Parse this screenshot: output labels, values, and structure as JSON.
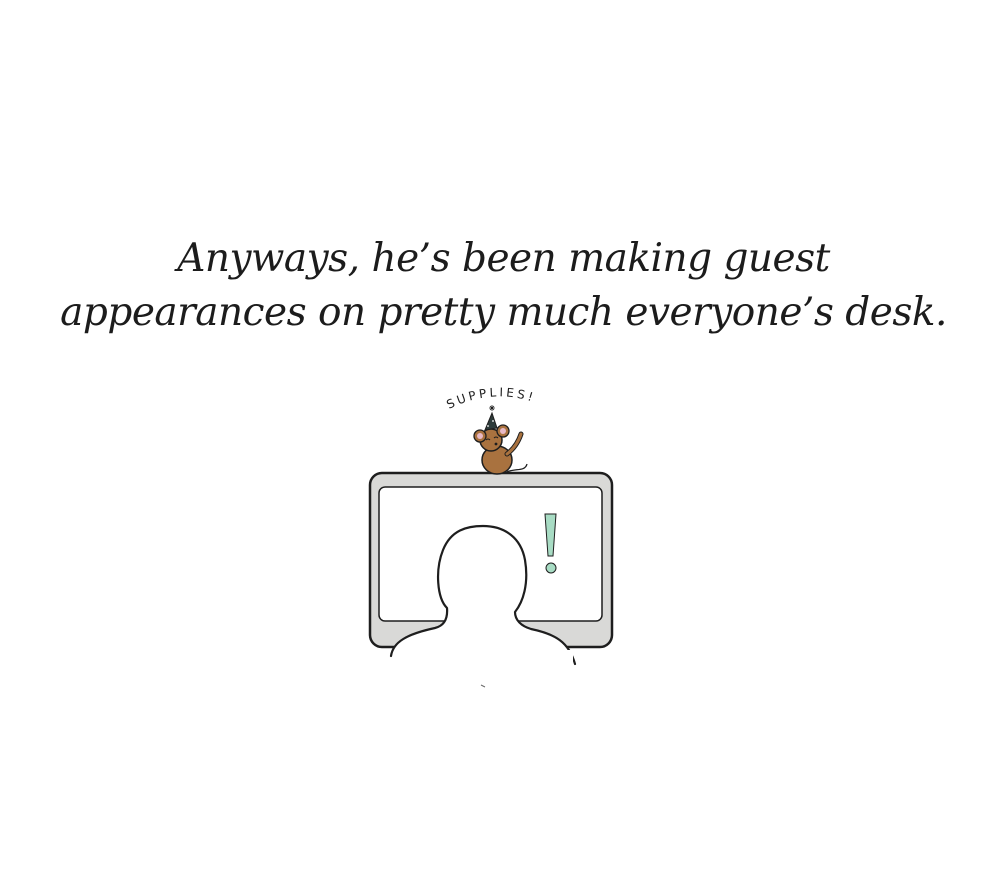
{
  "caption": {
    "line1": "Anyways, he’s been making guest",
    "line2": "appearances on pretty much everyone’s desk."
  },
  "illustration": {
    "speech_text": "SUPPLIES!",
    "colors": {
      "ink": "#1e1e1e",
      "monitor_frame": "#d9d9d7",
      "screen": "#ffffff",
      "exclamation": "#a8dcc4",
      "mouse_fur": "#a9723f",
      "mouse_ear": "#e8b9c6",
      "party_hat": "#2d3b3a"
    }
  }
}
